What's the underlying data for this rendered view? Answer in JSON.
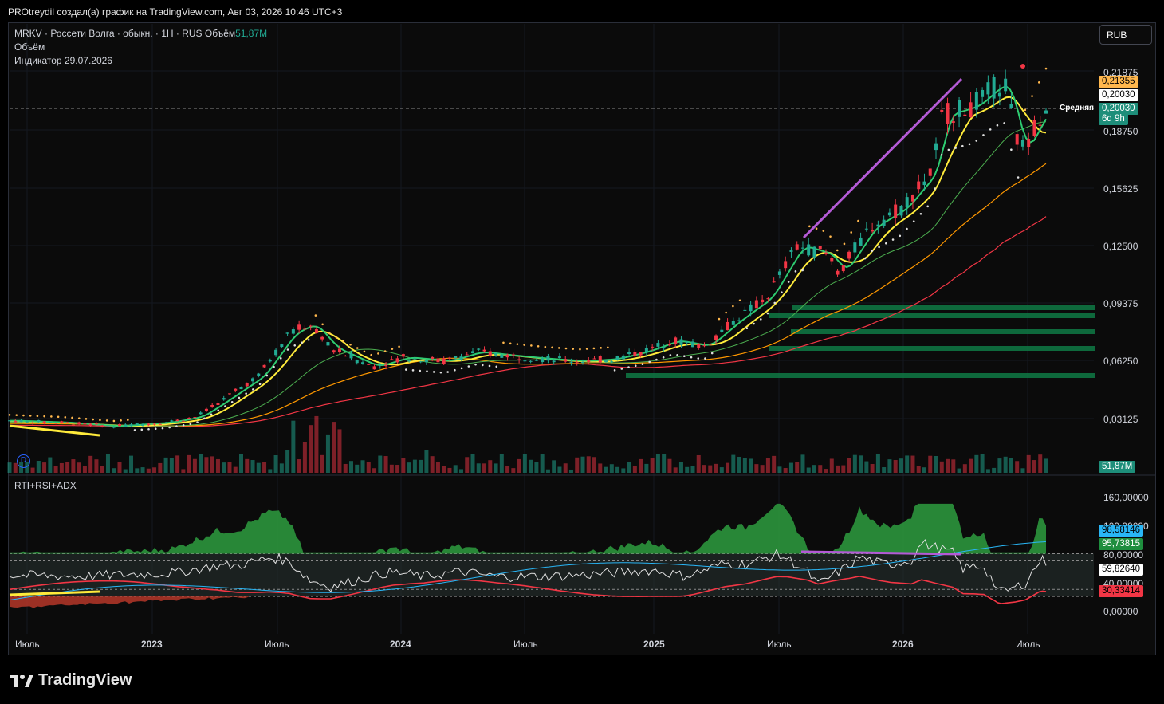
{
  "header": {
    "author_line": "PROtreydil создал(а) график на TradingView.com, Авг 03, 2026 10:46 UTC+3"
  },
  "main_chart": {
    "symbol_line": "MRKV · Россети Волга · обыкн. · 1H · RUS",
    "volume_label": "Объём",
    "volume_value": "51,87M",
    "legend_volume": "Объём",
    "legend_indicator": "Индикатор 29.07.2026",
    "currency_button": "RUB",
    "price_scale": [
      "0,21875",
      "0,18750",
      "0,15625",
      "0,12500",
      "0,09375",
      "0,06250",
      "0,03125"
    ],
    "tag_upper": "0,21355",
    "tag_white": "0,20030",
    "tag_last": "0,20030",
    "tag_countdown": "6d 9h",
    "avg_line_label": "Средняя",
    "volume_tag": "51,87M",
    "dividend_marker": "D"
  },
  "sub_chart": {
    "title": "RTI+RSI+ADX",
    "scale": [
      "160,00000",
      "100,00000",
      "80,00000",
      "40,00000",
      "0,00000"
    ],
    "tag_cyan": "98,58146",
    "tag_green": "95,73815",
    "tag_white": "59,82640",
    "tag_red": "30,33414"
  },
  "time_axis": [
    {
      "label": "Июль",
      "bold": false
    },
    {
      "label": "2023",
      "bold": true
    },
    {
      "label": "Июль",
      "bold": false
    },
    {
      "label": "2024",
      "bold": true
    },
    {
      "label": "Июль",
      "bold": false
    },
    {
      "label": "2025",
      "bold": true
    },
    {
      "label": "Июль",
      "bold": false
    },
    {
      "label": "2026",
      "bold": true
    },
    {
      "label": "Июль",
      "bold": false
    }
  ],
  "brand": {
    "name": "TradingView"
  },
  "colors": {
    "up": "#22ab94",
    "down": "#f23645",
    "ma_green": "#4caf50",
    "ma_yellow": "#ffeb3b",
    "ma_orange": "#ff9800",
    "ma_red": "#f23645",
    "trendline": "#b45ad6",
    "psar": "#ffb74d",
    "rsi_white": "#e0e0e0",
    "adx_cyan": "#29b6f6",
    "rti_red": "#f23645",
    "tag_orange": "#ffb74d",
    "tag_teal": "#1e8e7a"
  },
  "chart_data": {
    "type": "candlestick",
    "price_points": [
      [
        0,
        0.031
      ],
      [
        0.05,
        0.03
      ],
      [
        0.1,
        0.028
      ],
      [
        0.15,
        0.03
      ],
      [
        0.18,
        0.033
      ],
      [
        0.2,
        0.04
      ],
      [
        0.24,
        0.055
      ],
      [
        0.27,
        0.078
      ],
      [
        0.29,
        0.083
      ],
      [
        0.31,
        0.07
      ],
      [
        0.33,
        0.065
      ],
      [
        0.35,
        0.06
      ],
      [
        0.38,
        0.065
      ],
      [
        0.42,
        0.063
      ],
      [
        0.45,
        0.068
      ],
      [
        0.48,
        0.066
      ],
      [
        0.52,
        0.064
      ],
      [
        0.55,
        0.063
      ],
      [
        0.58,
        0.064
      ],
      [
        0.61,
        0.068
      ],
      [
        0.64,
        0.074
      ],
      [
        0.67,
        0.071
      ],
      [
        0.7,
        0.085
      ],
      [
        0.73,
        0.097
      ],
      [
        0.76,
        0.125
      ],
      [
        0.79,
        0.12
      ],
      [
        0.8,
        0.11
      ],
      [
        0.83,
        0.135
      ],
      [
        0.86,
        0.145
      ],
      [
        0.89,
        0.165
      ],
      [
        0.9,
        0.195
      ],
      [
        0.93,
        0.2
      ],
      [
        0.95,
        0.21
      ],
      [
        0.96,
        0.212
      ],
      [
        0.975,
        0.175
      ],
      [
        0.99,
        0.19
      ],
      [
        1.0,
        0.2
      ]
    ]
  }
}
